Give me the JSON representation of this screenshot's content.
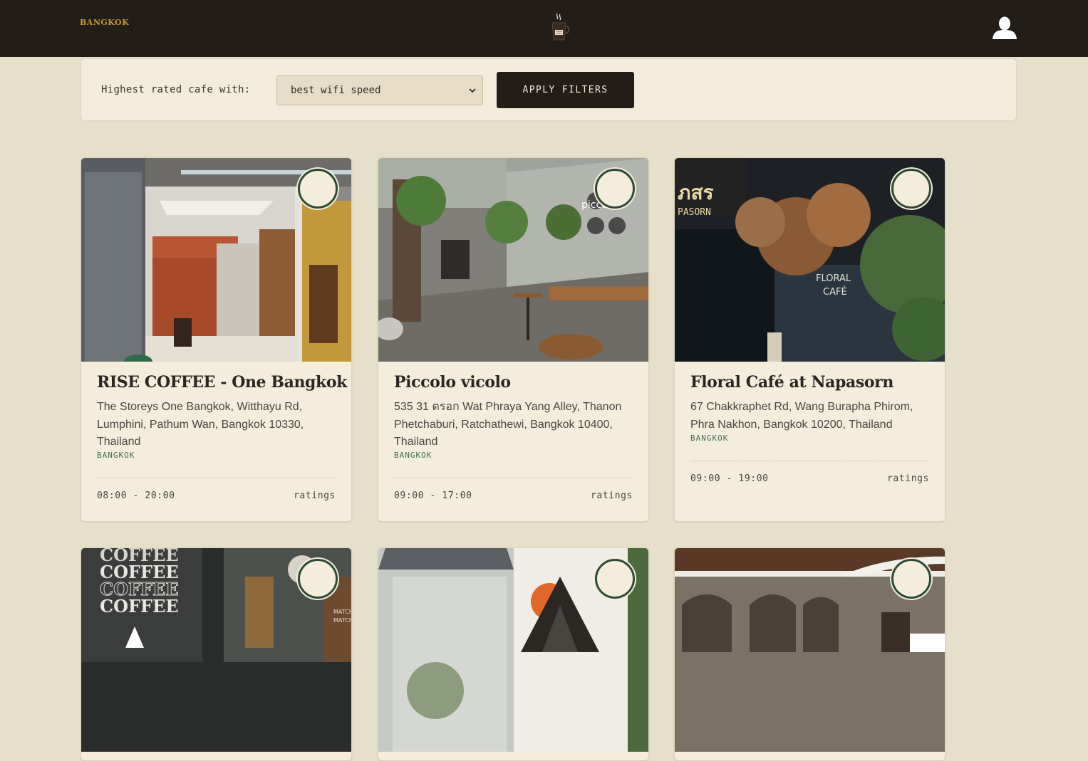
{
  "nav": {
    "city": "BANGKOK"
  },
  "filter": {
    "label": "Highest rated cafe with:",
    "selected": "best wifi speed",
    "apply_label": "APPLY FILTERS"
  },
  "cafes": [
    {
      "name": "RISE COFFEE - One Bangkok",
      "address": "The Storeys One Bangkok, Witthayu Rd, Lumphini, Pathum Wan, Bangkok 10330, Thailand",
      "city": "BANGKOK",
      "hours": "08:00 - 20:00",
      "ratings_label": "ratings"
    },
    {
      "name": "Piccolo vicolo",
      "address": "535 31 ตรอก Wat Phraya Yang Alley, Thanon Phetchaburi, Ratchathewi, Bangkok 10400, Thailand",
      "city": "BANGKOK",
      "hours": "09:00 - 17:00",
      "ratings_label": "ratings"
    },
    {
      "name": "Floral Café at Napasorn",
      "address": "67 Chakkraphet Rd, Wang Burapha Phirom, Phra Nakhon, Bangkok 10200, Thailand",
      "city": "BANGKOK",
      "hours": "09:00 - 19:00",
      "ratings_label": "ratings"
    },
    {},
    {},
    {}
  ],
  "photo_text": {
    "piccolo_sign": "piccolo",
    "floral_sign_thai": "ภสร",
    "floral_sign": "PASORN",
    "floral_window_1": "FLORAL",
    "floral_window_2": "CAFÉ",
    "coffee_word": "COFFEE",
    "matcha_word": "MATCHA"
  },
  "colors": {
    "nav_bg": "#231d18",
    "page_bg": "#e6dfca",
    "card_bg": "#f4eddc",
    "accent_gold": "#c8963a",
    "city_green": "#3e6c52",
    "badge_ring": "#2d4a35"
  },
  "icons": {
    "logo": "coffee-cup-icon",
    "user": "user-avatar-icon",
    "select": "chevron-down-icon",
    "favorite": "badge-ring-icon"
  }
}
